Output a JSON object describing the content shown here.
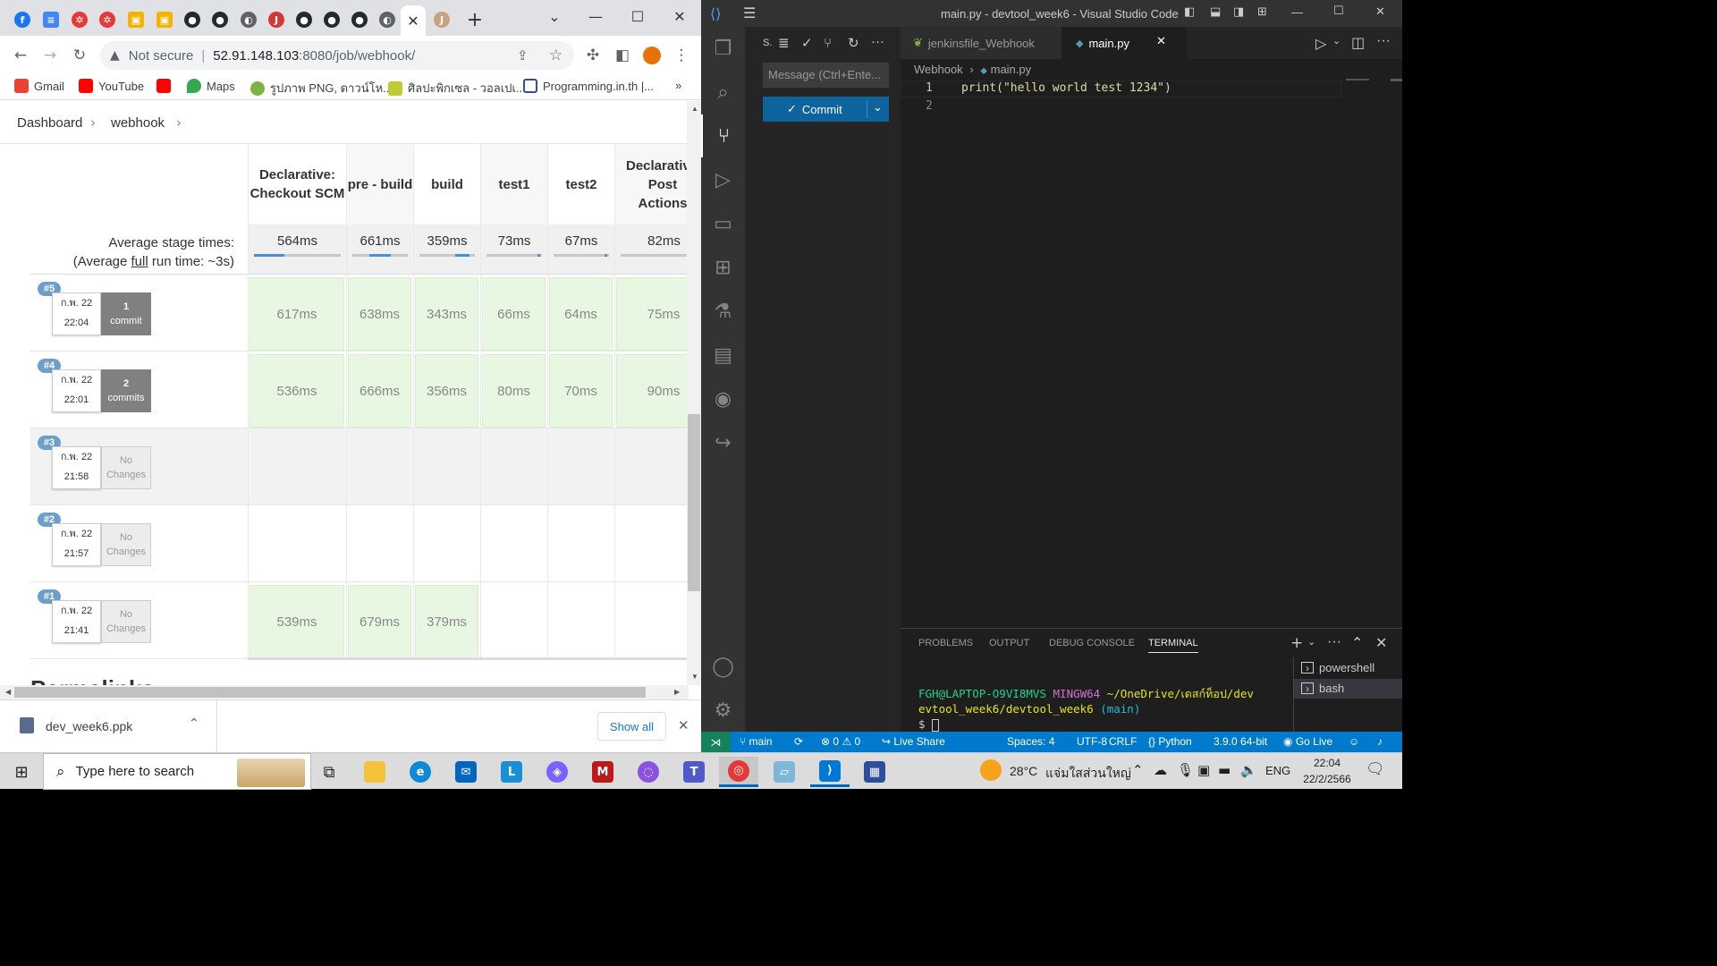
{
  "browser": {
    "address": {
      "security": "Not secure",
      "host": "52.91.148.103",
      "rest": ":8080/job/webhook/"
    },
    "bookmarks": [
      "Gmail",
      "YouTube",
      "",
      "Maps",
      "รูปภาพ PNG, ดาวน์โห...",
      "ศิลปะพิกเซล - วอลเปเ...",
      "Programming.in.th |..."
    ],
    "bookmarks_more": "»",
    "colors": {
      "accent": "#4a90d9",
      "stage_green": "#e8f7e1"
    }
  },
  "jenkins": {
    "breadcrumb": [
      "Dashboard",
      "webhook"
    ],
    "stages": [
      "Declarative: Checkout SCM",
      "pre - build",
      "build",
      "test1",
      "test2",
      "Declarative: Post Actions"
    ],
    "avg_label": "Average stage times:",
    "avg_note_prefix": "(Average ",
    "avg_note_link": "full",
    "avg_note_suffix": " run time: ~3s)",
    "avg_times": [
      "564ms",
      "661ms",
      "359ms",
      "73ms",
      "67ms",
      "82ms"
    ],
    "avg_bar_fractions": [
      0.35,
      0.4,
      0.25,
      0.05,
      0.05,
      0.05
    ],
    "builds": [
      {
        "num": "#5",
        "date": "ก.พ. 22",
        "time": "22:04",
        "commit_count": "1",
        "commit_word": "commit",
        "cells": [
          "617ms",
          "638ms",
          "343ms",
          "66ms",
          "64ms",
          "75ms"
        ]
      },
      {
        "num": "#4",
        "date": "ก.พ. 22",
        "time": "22:01",
        "commit_count": "2",
        "commit_word": "commits",
        "cells": [
          "536ms",
          "666ms",
          "356ms",
          "80ms",
          "70ms",
          "90ms"
        ]
      },
      {
        "num": "#3",
        "date": "ก.พ. 22",
        "time": "21:58",
        "commit_count": "No",
        "commit_word": "Changes",
        "cells": [
          "",
          "",
          "",
          "",
          "",
          ""
        ]
      },
      {
        "num": "#2",
        "date": "ก.พ. 22",
        "time": "21:57",
        "commit_count": "No",
        "commit_word": "Changes",
        "cells": [
          "",
          "",
          "",
          "",
          "",
          ""
        ]
      },
      {
        "num": "#1",
        "date": "ก.พ. 22",
        "time": "21:41",
        "commit_count": "No",
        "commit_word": "Changes",
        "cells": [
          "539ms",
          "679ms",
          "379ms",
          "",
          "",
          ""
        ]
      }
    ],
    "cut_heading": "Permalinks"
  },
  "downloads": {
    "file": "dev_week6.ppk",
    "show_all": "Show all"
  },
  "vscode": {
    "title": "main.py - devtool_week6 - Visual Studio Code",
    "scm_label": "S.",
    "message_placeholder": "Message (Ctrl+Ente...",
    "commit_label": "Commit",
    "tabs": [
      {
        "label": "jenkinsfile_Webhook",
        "active": false
      },
      {
        "label": "main.py",
        "active": true
      }
    ],
    "breadcrumb": [
      "Webhook",
      "main.py"
    ],
    "code_lines": [
      {
        "num": "1",
        "text": "print(\"hello world test 1234\")"
      },
      {
        "num": "2",
        "text": ""
      }
    ],
    "panel_tabs": [
      "PROBLEMS",
      "OUTPUT",
      "DEBUG CONSOLE",
      "TERMINAL"
    ],
    "terminal": {
      "user": "FGH@LAPTOP-O9VI8MVS",
      "env": "MINGW64",
      "path": "~/OneDrive/เดสก์ท็อป/dev",
      "path2": "evtool_week6/devtool_week6",
      "branch": "(main)",
      "prompt": "$"
    },
    "terminals": [
      "powershell",
      "bash"
    ],
    "status": {
      "branch": "main",
      "errors": "0",
      "warnings": "0",
      "live_share": "Live Share",
      "spaces": "Spaces: 4",
      "encoding": "UTF-8",
      "eol": "CRLF",
      "language": "Python",
      "interpreter": "3.9.0 64-bit",
      "go_live": "Go Live"
    }
  },
  "taskbar": {
    "search_placeholder": "Type here to search",
    "weather_temp": "28°C",
    "weather_text": "แจ่มใสส่วนใหญ่",
    "lang": "ENG",
    "time": "22:04",
    "date": "22/2/2566"
  }
}
